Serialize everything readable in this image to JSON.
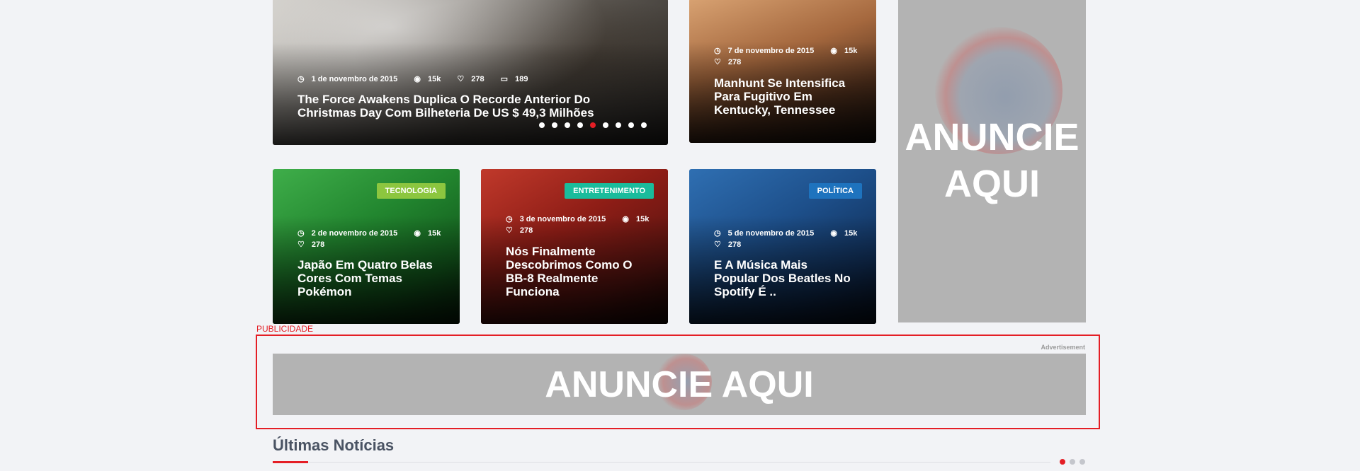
{
  "slider": {
    "date": "1 de novembro de 2015",
    "views": "15k",
    "likes": "278",
    "comments": "189",
    "title": "The Force Awakens Duplica O Recorde Anterior Do Christmas Day Com Bilheteria De US $ 49,3 Milhões",
    "dots_total": 9,
    "active_dot": 4
  },
  "side_story": {
    "date": "7 de novembro de 2015",
    "views": "15k",
    "likes": "278",
    "title": "Manhunt Se Intensifica Para Fugitivo Em Kentucky, Tennessee"
  },
  "grid": [
    {
      "category": "TECNOLOGIA",
      "category_color": "#8cc63f",
      "date": "2 de novembro de 2015",
      "views": "15k",
      "likes": "278",
      "title": "Japão Em Quatro Belas Cores Com Temas Pokémon"
    },
    {
      "category": "ENTRETENIMENTO",
      "category_color": "#1abc9c",
      "date": "3 de novembro de 2015",
      "views": "15k",
      "likes": "278",
      "title": "Nós Finalmente Descobrimos Como O BB-8 Realmente Funciona"
    },
    {
      "category": "POLÍTICA",
      "category_color": "#1e73be",
      "date": "5 de novembro de 2015",
      "views": "15k",
      "likes": "278",
      "title": "E A Música Mais Popular Dos Beatles No Spotify É .."
    }
  ],
  "sidebar_ad": {
    "line1": "ANUNCIE",
    "line2": "AQUI"
  },
  "banner": {
    "label": "PUBLICIDADE",
    "advertisement": "Advertisement",
    "text": "ANUNCIE AQUI"
  },
  "latest": {
    "heading": "Últimas Notícias",
    "pages_total": 3,
    "active_page": 0
  },
  "colors": {
    "accent": "#e41e25",
    "ad_gray": "#b3b3b3",
    "background": "#f2f3f6"
  }
}
